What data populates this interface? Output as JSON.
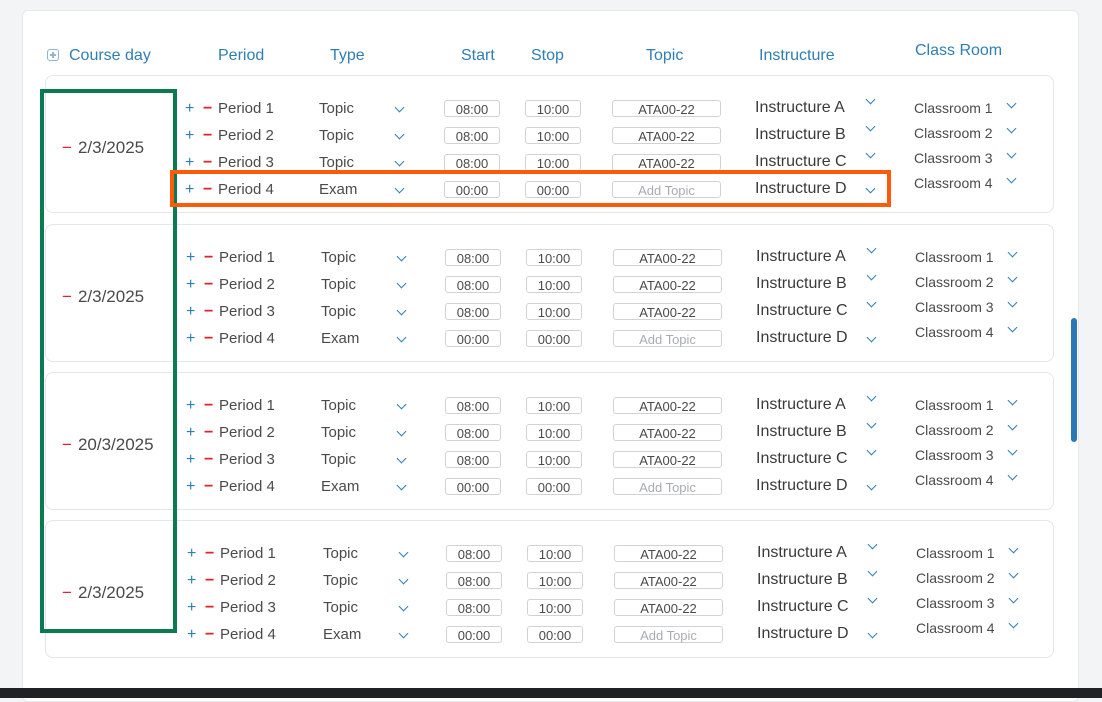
{
  "header": {
    "course_day": "Course day",
    "period": "Period",
    "type": "Type",
    "start": "Start",
    "stop": "Stop",
    "topic": "Topic",
    "instructure": "Instructure",
    "class_room": "Class Room"
  },
  "symbols": {
    "add": "+",
    "remove": "−"
  },
  "groups": [
    {
      "date": "2/3/2025",
      "rows": [
        {
          "period": "Period 1",
          "type": "Topic",
          "start": "08:00",
          "stop": "10:00",
          "topic": "ATA00-22",
          "instructure": "Instructure A",
          "room": "Classroom 1"
        },
        {
          "period": "Period 2",
          "type": "Topic",
          "start": "08:00",
          "stop": "10:00",
          "topic": "ATA00-22",
          "instructure": "Instructure B",
          "room": "Classroom 2"
        },
        {
          "period": "Period 3",
          "type": "Topic",
          "start": "08:00",
          "stop": "10:00",
          "topic": "ATA00-22",
          "instructure": "Instructure C",
          "room": "Classroom 3"
        },
        {
          "period": "Period 4",
          "type": "Exam",
          "start": "00:00",
          "stop": "00:00",
          "topic": "Add Topic",
          "instructure": "Instructure D",
          "room": "Classroom 4"
        }
      ]
    },
    {
      "date": "2/3/2025",
      "rows": [
        {
          "period": "Period 1",
          "type": "Topic",
          "start": "08:00",
          "stop": "10:00",
          "topic": "ATA00-22",
          "instructure": "Instructure A",
          "room": "Classroom 1"
        },
        {
          "period": "Period 2",
          "type": "Topic",
          "start": "08:00",
          "stop": "10:00",
          "topic": "ATA00-22",
          "instructure": "Instructure B",
          "room": "Classroom 2"
        },
        {
          "period": "Period 3",
          "type": "Topic",
          "start": "08:00",
          "stop": "10:00",
          "topic": "ATA00-22",
          "instructure": "Instructure C",
          "room": "Classroom 3"
        },
        {
          "period": "Period 4",
          "type": "Exam",
          "start": "00:00",
          "stop": "00:00",
          "topic": "Add Topic",
          "instructure": "Instructure D",
          "room": "Classroom 4"
        }
      ]
    },
    {
      "date": "20/3/2025",
      "rows": [
        {
          "period": "Period 1",
          "type": "Topic",
          "start": "08:00",
          "stop": "10:00",
          "topic": "ATA00-22",
          "instructure": "Instructure A",
          "room": "Classroom 1"
        },
        {
          "period": "Period 2",
          "type": "Topic",
          "start": "08:00",
          "stop": "10:00",
          "topic": "ATA00-22",
          "instructure": "Instructure B",
          "room": "Classroom 2"
        },
        {
          "period": "Period 3",
          "type": "Topic",
          "start": "08:00",
          "stop": "10:00",
          "topic": "ATA00-22",
          "instructure": "Instructure C",
          "room": "Classroom 3"
        },
        {
          "period": "Period 4",
          "type": "Exam",
          "start": "00:00",
          "stop": "00:00",
          "topic": "Add Topic",
          "instructure": "Instructure D",
          "room": "Classroom 4"
        }
      ]
    },
    {
      "date": "2/3/2025",
      "rows": [
        {
          "period": "Period 1",
          "type": "Topic",
          "start": "08:00",
          "stop": "10:00",
          "topic": "ATA00-22",
          "instructure": "Instructure A",
          "room": "Classroom 1"
        },
        {
          "period": "Period 2",
          "type": "Topic",
          "start": "08:00",
          "stop": "10:00",
          "topic": "ATA00-22",
          "instructure": "Instructure B",
          "room": "Classroom 2"
        },
        {
          "period": "Period 3",
          "type": "Topic",
          "start": "08:00",
          "stop": "10:00",
          "topic": "ATA00-22",
          "instructure": "Instructure C",
          "room": "Classroom 3"
        },
        {
          "period": "Period 4",
          "type": "Exam",
          "start": "00:00",
          "stop": "00:00",
          "topic": "Add Topic",
          "instructure": "Instructure D",
          "room": "Classroom 4"
        }
      ]
    }
  ],
  "colors": {
    "accent": "#2f7fb3",
    "remove": "#e0222a",
    "highlight_column": "#0a7a50",
    "highlight_row": "#ff5a0a",
    "scrollbar": "#2a78b8"
  }
}
